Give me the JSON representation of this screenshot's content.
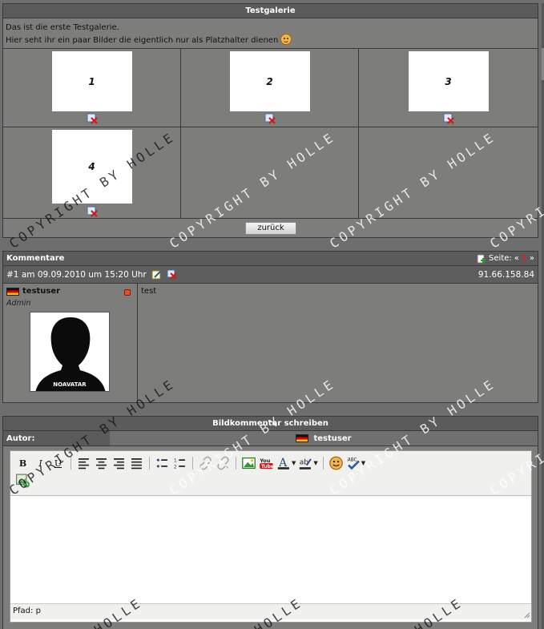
{
  "gallery": {
    "title": "Testgalerie",
    "description_line1": "Das ist die erste Testgalerie.",
    "description_line2": "Hier seht ihr ein paar Bilder die eigentlich nur als Platzhalter dienen",
    "images": [
      {
        "label": "1"
      },
      {
        "label": "2"
      },
      {
        "label": "3"
      },
      {
        "label": "4"
      }
    ],
    "back_button": "zurück"
  },
  "comments": {
    "title": "Kommentare",
    "page_label": "Seite:",
    "prev": "«",
    "current_page": "1",
    "next": "»",
    "items": [
      {
        "header": "#1 am 09.09.2010 um 15:20 Uhr",
        "ip": "91.66.158.84",
        "username": "testuser",
        "role": "Admin",
        "avatar_label": "NOAVATAR",
        "text": "test"
      }
    ]
  },
  "write": {
    "title": "Bildkommentar schreiben",
    "author_label": "Autor:",
    "author_name": "testuser",
    "path_label": "Pfad: p"
  },
  "watermark": {
    "text": "COPYRIGHT BY HOLLE",
    "text_short": "HOLLE"
  },
  "colors": {
    "header": "#5b5b5b",
    "panel": "#7d7d7b",
    "flag_black": "#111111",
    "flag_red": "#dd0000",
    "flag_gold": "#f3c400"
  }
}
